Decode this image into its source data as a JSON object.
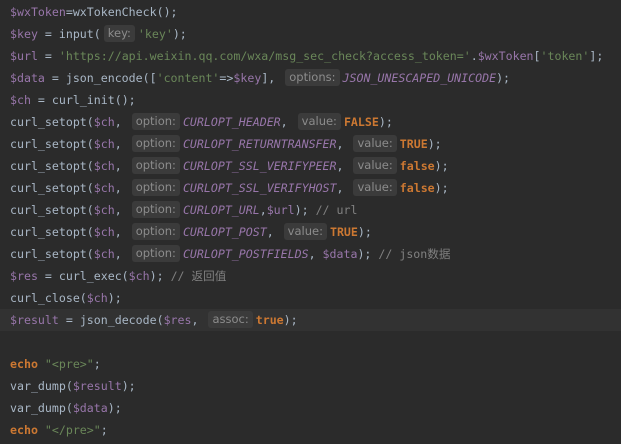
{
  "colors": {
    "background": "#2b2b2b",
    "current_line": "#323232",
    "variable": "#9876aa",
    "default_text": "#a9b7c6",
    "string": "#6a8759",
    "keyword": "#cc7832",
    "comment": "#808080",
    "constant": "#9876aa",
    "inlay_hint_bg": "#3b3b3b",
    "inlay_hint_text": "#8c8c8c"
  },
  "lines": [
    [
      {
        "t": "v",
        "x": "$wxToken"
      },
      {
        "t": "d",
        "x": "=wxTokenCheck();"
      }
    ],
    [
      {
        "t": "v",
        "x": "$key"
      },
      {
        "t": "d",
        "x": " = input("
      },
      {
        "t": "hint",
        "x": "key:"
      },
      {
        "t": "s",
        "x": "'key'"
      },
      {
        "t": "d",
        "x": ");"
      }
    ],
    [
      {
        "t": "v",
        "x": "$url"
      },
      {
        "t": "d",
        "x": " = "
      },
      {
        "t": "s",
        "x": "'https://api.weixin.qq.com/wxa/msg_sec_check?access_token='"
      },
      {
        "t": "d",
        "x": "."
      },
      {
        "t": "v",
        "x": "$wxToken"
      },
      {
        "t": "d",
        "x": "["
      },
      {
        "t": "s",
        "x": "'token'"
      },
      {
        "t": "d",
        "x": "];"
      }
    ],
    [
      {
        "t": "v",
        "x": "$data"
      },
      {
        "t": "d",
        "x": " = json_encode(["
      },
      {
        "t": "s",
        "x": "'content'"
      },
      {
        "t": "d",
        "x": "=>"
      },
      {
        "t": "v",
        "x": "$key"
      },
      {
        "t": "d",
        "x": "], "
      },
      {
        "t": "hint",
        "x": "options:"
      },
      {
        "t": "c",
        "x": "JSON_UNESCAPED_UNICODE"
      },
      {
        "t": "d",
        "x": ");"
      }
    ],
    [
      {
        "t": "v",
        "x": "$ch"
      },
      {
        "t": "d",
        "x": " = curl_init();"
      }
    ],
    [
      {
        "t": "d",
        "x": "curl_setopt("
      },
      {
        "t": "v",
        "x": "$ch"
      },
      {
        "t": "d",
        "x": ", "
      },
      {
        "t": "hint",
        "x": "option:"
      },
      {
        "t": "c",
        "x": "CURLOPT_HEADER"
      },
      {
        "t": "d",
        "x": ", "
      },
      {
        "t": "hint",
        "x": "value:"
      },
      {
        "t": "k",
        "x": "FALSE"
      },
      {
        "t": "d",
        "x": ");"
      }
    ],
    [
      {
        "t": "d",
        "x": "curl_setopt("
      },
      {
        "t": "v",
        "x": "$ch"
      },
      {
        "t": "d",
        "x": ", "
      },
      {
        "t": "hint",
        "x": "option:"
      },
      {
        "t": "c",
        "x": "CURLOPT_RETURNTRANSFER"
      },
      {
        "t": "d",
        "x": ", "
      },
      {
        "t": "hint",
        "x": "value:"
      },
      {
        "t": "k",
        "x": "TRUE"
      },
      {
        "t": "d",
        "x": ");"
      }
    ],
    [
      {
        "t": "d",
        "x": "curl_setopt("
      },
      {
        "t": "v",
        "x": "$ch"
      },
      {
        "t": "d",
        "x": ", "
      },
      {
        "t": "hint",
        "x": "option:"
      },
      {
        "t": "c",
        "x": "CURLOPT_SSL_VERIFYPEER"
      },
      {
        "t": "d",
        "x": ", "
      },
      {
        "t": "hint",
        "x": "value:"
      },
      {
        "t": "k",
        "x": "false"
      },
      {
        "t": "d",
        "x": ");"
      }
    ],
    [
      {
        "t": "d",
        "x": "curl_setopt("
      },
      {
        "t": "v",
        "x": "$ch"
      },
      {
        "t": "d",
        "x": ", "
      },
      {
        "t": "hint",
        "x": "option:"
      },
      {
        "t": "c",
        "x": "CURLOPT_SSL_VERIFYHOST"
      },
      {
        "t": "d",
        "x": ", "
      },
      {
        "t": "hint",
        "x": "value:"
      },
      {
        "t": "k",
        "x": "false"
      },
      {
        "t": "d",
        "x": ");"
      }
    ],
    [
      {
        "t": "d",
        "x": "curl_setopt("
      },
      {
        "t": "v",
        "x": "$ch"
      },
      {
        "t": "d",
        "x": ", "
      },
      {
        "t": "hint",
        "x": "option:"
      },
      {
        "t": "c",
        "x": "CURLOPT_URL"
      },
      {
        "t": "d",
        "x": ","
      },
      {
        "t": "v",
        "x": "$url"
      },
      {
        "t": "d",
        "x": "); "
      },
      {
        "t": "co",
        "x": "// url"
      }
    ],
    [
      {
        "t": "d",
        "x": "curl_setopt("
      },
      {
        "t": "v",
        "x": "$ch"
      },
      {
        "t": "d",
        "x": ", "
      },
      {
        "t": "hint",
        "x": "option:"
      },
      {
        "t": "c",
        "x": "CURLOPT_POST"
      },
      {
        "t": "d",
        "x": ", "
      },
      {
        "t": "hint",
        "x": "value:"
      },
      {
        "t": "k",
        "x": "TRUE"
      },
      {
        "t": "d",
        "x": ");"
      }
    ],
    [
      {
        "t": "d",
        "x": "curl_setopt("
      },
      {
        "t": "v",
        "x": "$ch"
      },
      {
        "t": "d",
        "x": ", "
      },
      {
        "t": "hint",
        "x": "option:"
      },
      {
        "t": "c",
        "x": "CURLOPT_POSTFIELDS"
      },
      {
        "t": "d",
        "x": ", "
      },
      {
        "t": "v",
        "x": "$data"
      },
      {
        "t": "d",
        "x": "); "
      },
      {
        "t": "co",
        "x": "// json数据"
      }
    ],
    [
      {
        "t": "v",
        "x": "$res"
      },
      {
        "t": "d",
        "x": " = curl_exec("
      },
      {
        "t": "v",
        "x": "$ch"
      },
      {
        "t": "d",
        "x": "); "
      },
      {
        "t": "co",
        "x": "// 返回值"
      }
    ],
    [
      {
        "t": "d",
        "x": "curl_close("
      },
      {
        "t": "v",
        "x": "$ch"
      },
      {
        "t": "d",
        "x": ");"
      }
    ],
    [
      {
        "t": "v",
        "x": "$result"
      },
      {
        "t": "d",
        "x": " = json_decode("
      },
      {
        "t": "v",
        "x": "$res"
      },
      {
        "t": "d",
        "x": ", "
      },
      {
        "t": "hint",
        "x": "assoc:"
      },
      {
        "t": "k",
        "x": "true"
      },
      {
        "t": "d",
        "x": ");"
      }
    ],
    [],
    [
      {
        "t": "k",
        "x": "echo"
      },
      {
        "t": "d",
        "x": " "
      },
      {
        "t": "s",
        "x": "\"<pre>\""
      },
      {
        "t": "d",
        "x": ";"
      }
    ],
    [
      {
        "t": "d",
        "x": "var_dump("
      },
      {
        "t": "v",
        "x": "$result"
      },
      {
        "t": "d",
        "x": ");"
      }
    ],
    [
      {
        "t": "d",
        "x": "var_dump("
      },
      {
        "t": "v",
        "x": "$data"
      },
      {
        "t": "d",
        "x": ");"
      }
    ],
    [
      {
        "t": "k",
        "x": "echo"
      },
      {
        "t": "d",
        "x": " "
      },
      {
        "t": "s",
        "x": "\"</pre>\""
      },
      {
        "t": "d",
        "x": ";"
      }
    ]
  ],
  "current_line": 14
}
